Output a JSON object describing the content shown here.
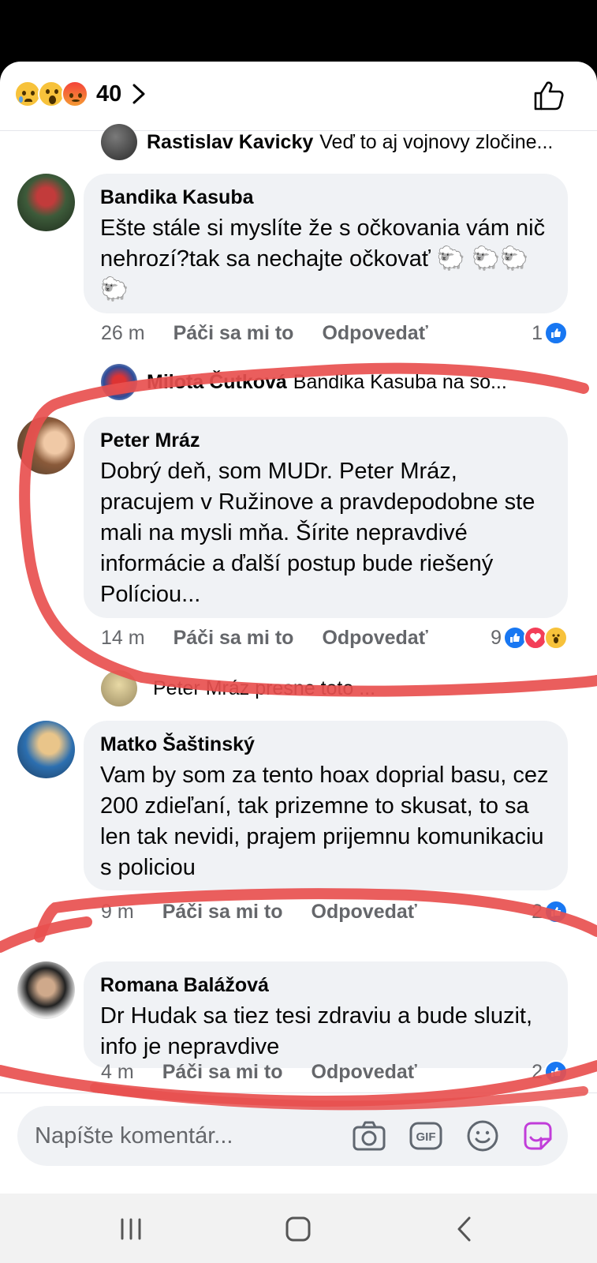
{
  "header": {
    "reaction_count": "40",
    "reaction_icons": [
      "sad-emoji",
      "wow-emoji",
      "angry-emoji"
    ],
    "like_icon": "thumbs-up-outline-icon"
  },
  "reply_previews": [
    {
      "name": "Rastislav Kavicky",
      "text": "Veď to aj vojnovy zločine..."
    },
    {
      "name": "Milota Čutková",
      "text": "Bandika Kasuba na so..."
    },
    {
      "name": "",
      "text": "Peter Mráz presne toto ..."
    }
  ],
  "comments": [
    {
      "name": "Bandika Kasuba",
      "text": "Ešte stále si myslíte že s očkovania vám nič nehrozí?tak sa nechajte očkovať 🐑 🐑🐑🐑",
      "time": "26 m",
      "like_label": "Páči sa mi to",
      "reply_label": "Odpovedať",
      "reaction_count": "1",
      "reactions": [
        "like"
      ]
    },
    {
      "name": "Peter Mráz",
      "text": "Dobrý deň, som MUDr. Peter Mráz, pracujem v Ružinove a pravdepodobne ste mali na mysli mňa. Šírite nepravdivé informácie a ďalší postup bude riešený Políciou...",
      "time": "14 m",
      "like_label": "Páči sa mi to",
      "reply_label": "Odpovedať",
      "reaction_count": "9",
      "reactions": [
        "like",
        "love",
        "wow"
      ]
    },
    {
      "name": "Matko Šaštinský",
      "text": "Vam by som za tento hoax doprial basu, cez 200 zdieľaní, tak prizemne to skusat, to sa len tak nevidi, prajem prijemnu komunikaciu s policiou",
      "time": "9 m",
      "like_label": "Páči sa mi to",
      "reply_label": "Odpovedať",
      "reaction_count": "2",
      "reactions": [
        "like"
      ]
    },
    {
      "name": "Romana Balážová",
      "text": "Dr Hudak sa tiez tesi zdraviu a bude sluzit, info je nepravdive",
      "time": "4 m",
      "like_label": "Páči sa mi to",
      "reply_label": "Odpovedať",
      "reaction_count": "2",
      "reactions": [
        "like"
      ]
    }
  ],
  "composer": {
    "placeholder": "Napíšte komentár...",
    "icons": [
      "camera-icon",
      "gif-icon",
      "emoji-icon",
      "sticker-icon"
    ]
  },
  "colors": {
    "accent": "#1877f2",
    "bubble": "#f0f2f5",
    "secondary_text": "#65676b",
    "annotation": "#e8504f"
  }
}
